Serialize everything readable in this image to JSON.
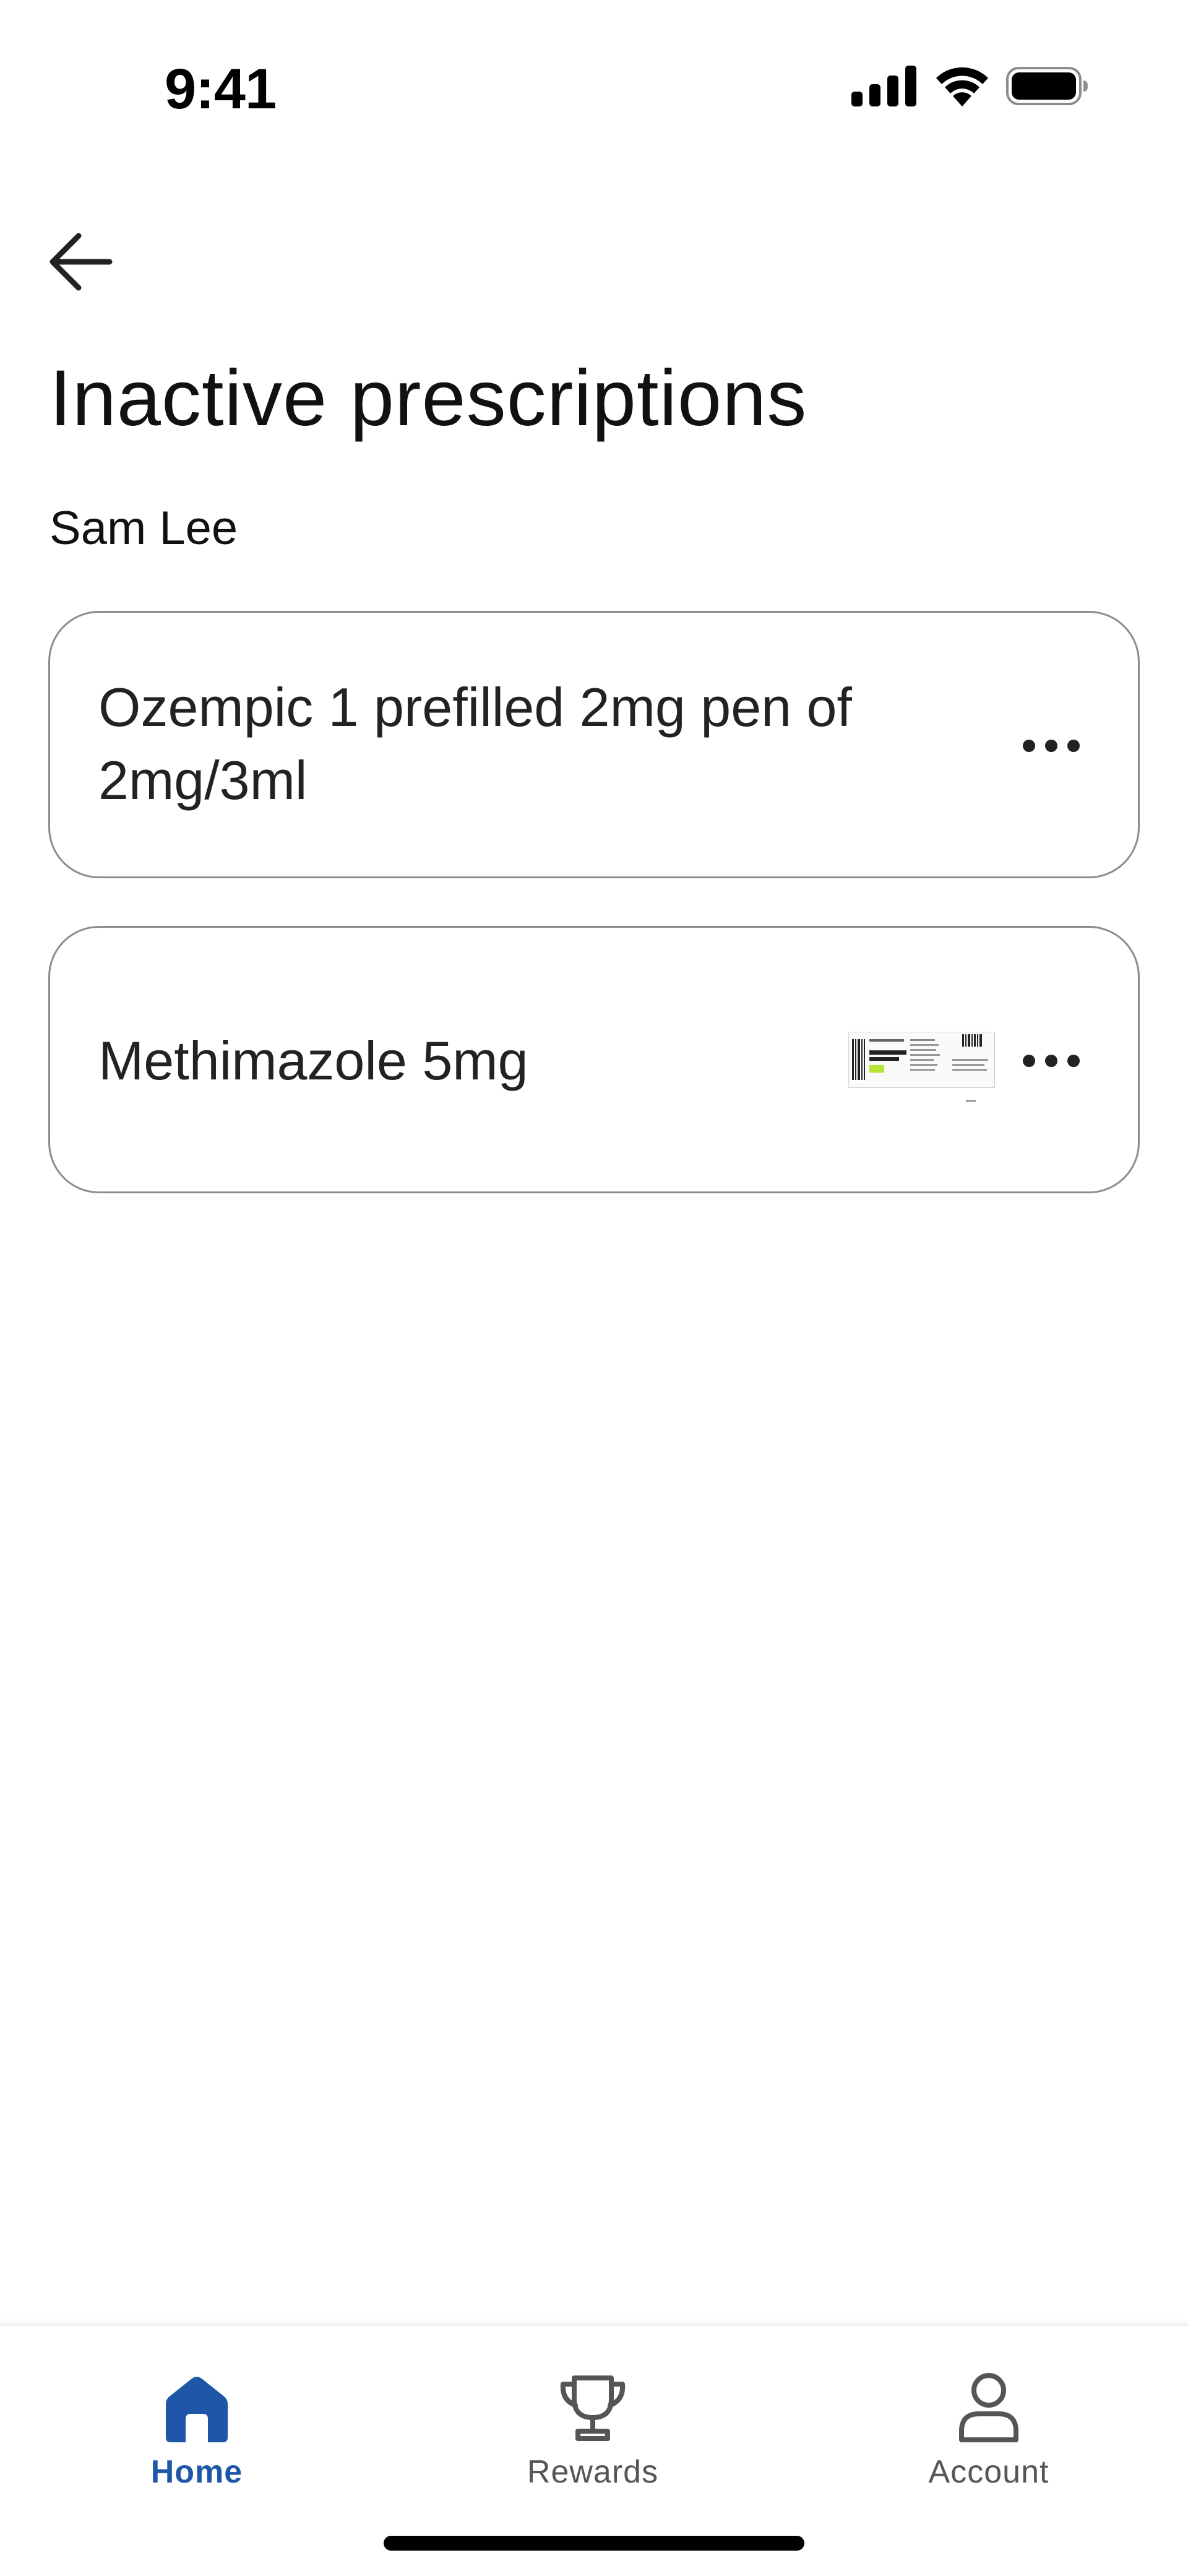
{
  "status_bar": {
    "time": "9:41",
    "icons": [
      "signal-icon",
      "wifi-icon",
      "battery-icon"
    ]
  },
  "header": {
    "back_icon": "arrow-left-icon",
    "title": "Inactive prescriptions",
    "patient_name": "Sam Lee"
  },
  "prescriptions": [
    {
      "name": "Ozempic 1 prefilled 2mg pen of 2mg/3ml",
      "has_image": false,
      "menu_icon": "more-horizontal-icon"
    },
    {
      "name": "Methimazole 5mg",
      "has_image": true,
      "menu_icon": "more-horizontal-icon"
    }
  ],
  "tab_bar": {
    "active_color": "#1e56a8",
    "tabs": [
      {
        "label": "Home",
        "icon": "home-icon",
        "active": true
      },
      {
        "label": "Rewards",
        "icon": "trophy-icon",
        "active": false
      },
      {
        "label": "Account",
        "icon": "person-icon",
        "active": false
      }
    ]
  }
}
